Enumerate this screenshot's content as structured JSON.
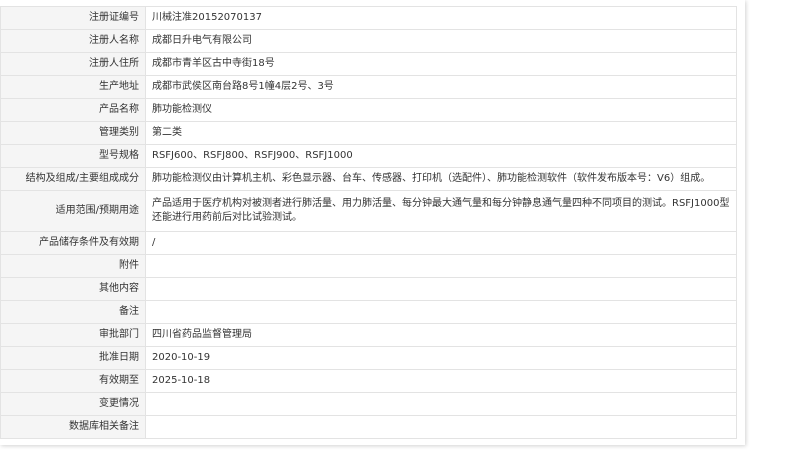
{
  "rows": [
    {
      "label": "注册证编号",
      "value": "川械注准20152070137"
    },
    {
      "label": "注册人名称",
      "value": "成都日升电气有限公司"
    },
    {
      "label": "注册人住所",
      "value": "成都市青羊区古中寺街18号"
    },
    {
      "label": "生产地址",
      "value": "成都市武侯区南台路8号1幢4层2号、3号"
    },
    {
      "label": "产品名称",
      "value": "肺功能检测仪"
    },
    {
      "label": "管理类别",
      "value": "第二类"
    },
    {
      "label": "型号规格",
      "value": "RSFJ600、RSFJ800、RSFJ900、RSFJ1000"
    },
    {
      "label": "结构及组成/主要组成成分",
      "value": "肺功能检测仪由计算机主机、彩色显示器、台车、传感器、打印机（选配件）、肺功能检测软件（软件发布版本号：V6）组成。"
    },
    {
      "label": "适用范围/预期用途",
      "value": "产品适用于医疗机构对被测者进行肺活量、用力肺活量、每分钟最大通气量和每分钟静息通气量四种不同项目的测试。RSFJ1000型还能进行用药前后对比试验测试。"
    },
    {
      "label": "产品储存条件及有效期",
      "value": "/"
    },
    {
      "label": "附件",
      "value": ""
    },
    {
      "label": "其他内容",
      "value": ""
    },
    {
      "label": "备注",
      "value": ""
    },
    {
      "label": "审批部门",
      "value": "四川省药品监督管理局"
    },
    {
      "label": "批准日期",
      "value": "2020-10-19"
    },
    {
      "label": "有效期至",
      "value": "2025-10-18"
    },
    {
      "label": "变更情况",
      "value": ""
    },
    {
      "label": "数据库相关备注",
      "value": ""
    }
  ]
}
